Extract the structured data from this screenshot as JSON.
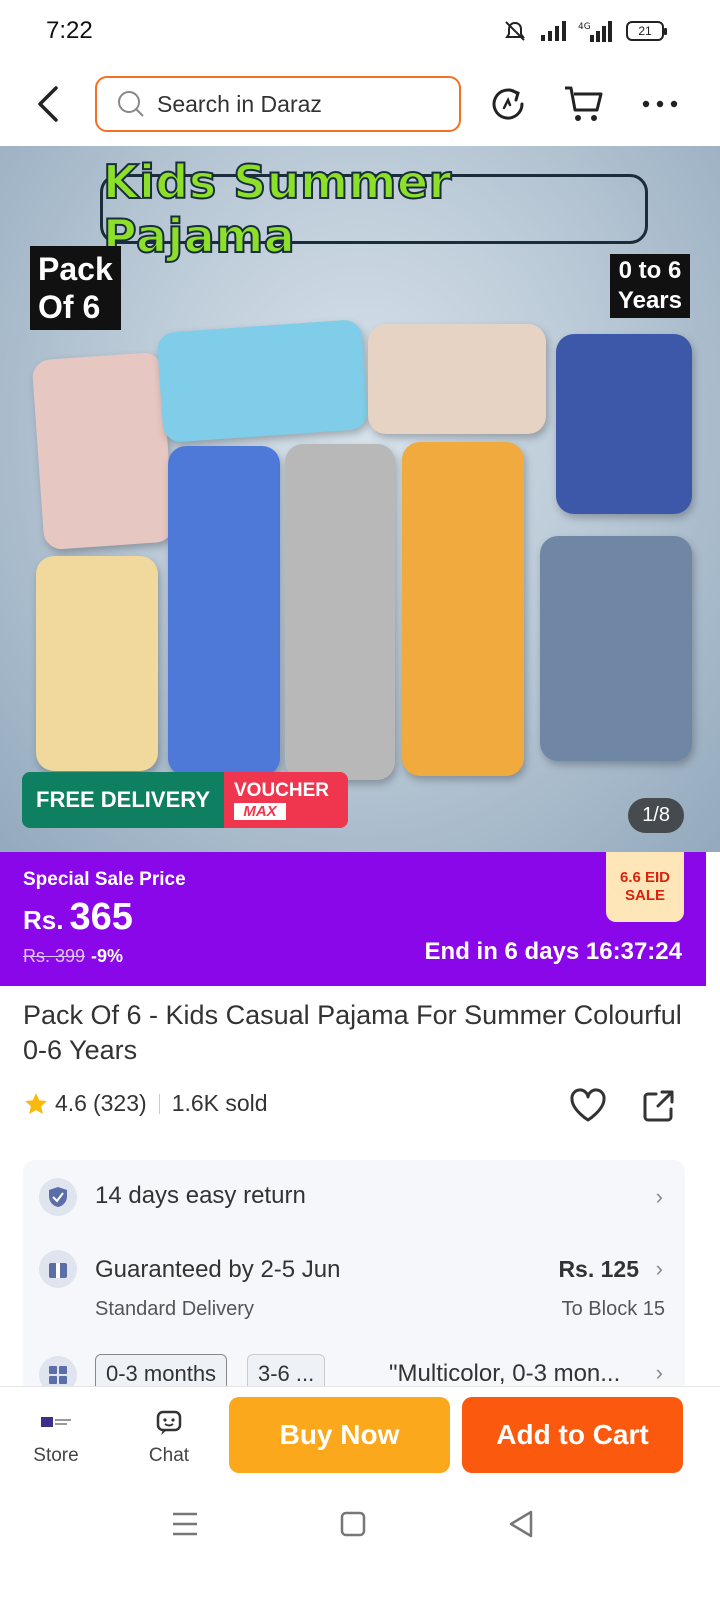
{
  "status_bar": {
    "time": "7:22",
    "battery": "21"
  },
  "nav": {
    "search_placeholder": "Search in Daraz"
  },
  "hero": {
    "title": "Kids Summer Pajama",
    "pack_line1": "Pack",
    "pack_line2": "Of 6",
    "age_line1": "0 to 6",
    "age_line2": "Years",
    "free_delivery": "FREE DELIVERY",
    "voucher_line1": "VOUCHER",
    "voucher_line2": "MAX",
    "image_counter": "1/8"
  },
  "sale": {
    "label": "Special Sale Price",
    "currency": "Rs.",
    "price": "365",
    "old_price": "Rs. 399",
    "discount": "-9%",
    "badge_line1": "6.6 EID",
    "badge_line2": "SALE",
    "ends": "End in 6 days 16:37:24"
  },
  "product": {
    "title": "Pack Of 6 - Kids Casual Pajama For Summer Colourful 0-6 Years",
    "rating": "4.6",
    "reviews": "(323)",
    "sold": "1.6K sold"
  },
  "services": {
    "return_text": "14 days easy return",
    "delivery_text": "Guaranteed by 2-5 Jun",
    "delivery_type": "Standard Delivery",
    "delivery_price": "Rs. 125",
    "delivery_to": "To Block 15",
    "variant_chip1": "0-3 months",
    "variant_chip2": "3-6 ...",
    "variant_selected": "\"Multicolor, 0-3 mon..."
  },
  "bottom_bar": {
    "store_label": "Store",
    "chat_label": "Chat",
    "buy_now": "Buy Now",
    "add_to_cart": "Add to Cart"
  },
  "colors": {
    "brand_orange": "#fb5a0e",
    "buy_now_yellow": "#fba81c",
    "sale_purple": "#8a07ea",
    "free_delivery_green": "#0e7f60",
    "voucher_red": "#f0364f"
  }
}
